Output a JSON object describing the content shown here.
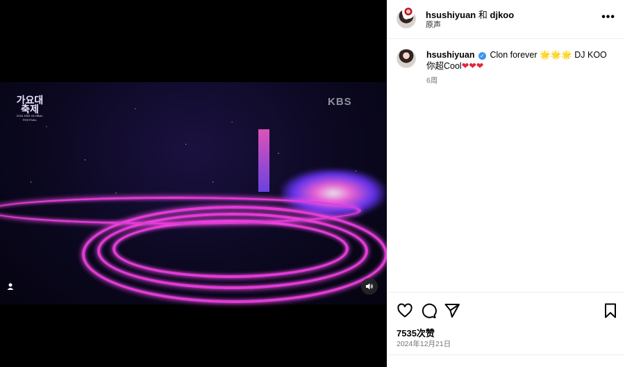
{
  "media": {
    "stage_logo": "가요대축제",
    "stage_logo_sub": "2024 KBS GLOBAL FESTIVAL",
    "broadcaster_watermark": "KBS",
    "icons": {
      "user_tag": "user-tag-icon",
      "audio": "speaker-icon"
    }
  },
  "header": {
    "user1": "hsushiyuan",
    "joiner": "和",
    "user2": "djkoo",
    "audio_label": "原声",
    "more_icon": "more-horizontal-icon"
  },
  "caption": {
    "username": "hsushiyuan",
    "verified": true,
    "text_part1": "Clon forever",
    "text_part2": "DJ KOO你超Cool",
    "sun_emoji": "🌟",
    "heart_emoji": "❤",
    "time_ago": "6周"
  },
  "actions": {
    "like_icon": "heart-icon",
    "comment_icon": "comment-icon",
    "share_icon": "send-icon",
    "save_icon": "bookmark-icon"
  },
  "stats": {
    "likes": "7535次赞",
    "date": "2024年12月21日"
  },
  "colors": {
    "verified": "#3897f0",
    "heart": "#e0253a",
    "secondary_text": "#737373"
  }
}
